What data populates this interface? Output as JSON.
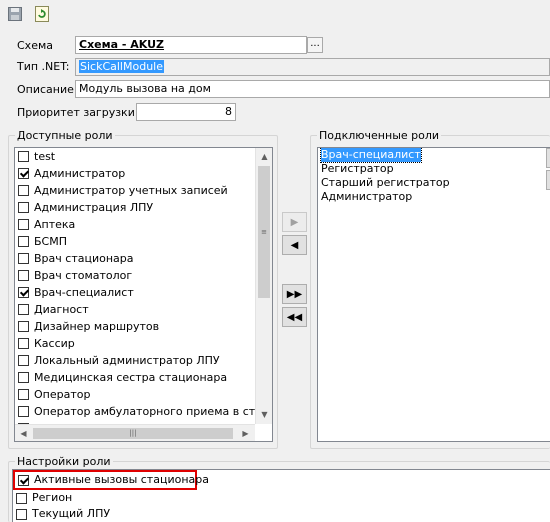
{
  "toolbar": {
    "save_icon": "save-icon",
    "refresh_icon": "refresh-icon"
  },
  "form": {
    "schema_label": "Схема",
    "schema_value": "Схема - AKUZ",
    "schema_button": "...",
    "type_label": "Тип .NET:",
    "type_value": "SickCallModule",
    "desc_label": "Описание:",
    "desc_value": "Модуль вызова на дом",
    "priority_label": "Приоритет загрузки:",
    "priority_value": "8"
  },
  "available_roles": {
    "title": "Доступные роли",
    "items": [
      {
        "label": "test",
        "checked": false
      },
      {
        "label": "Администратор",
        "checked": true
      },
      {
        "label": "Администратор учетных записей",
        "checked": false
      },
      {
        "label": "Администрация ЛПУ",
        "checked": false
      },
      {
        "label": "Аптека",
        "checked": false
      },
      {
        "label": "БСМП",
        "checked": false
      },
      {
        "label": "Врач стационара",
        "checked": false
      },
      {
        "label": "Врач стоматолог",
        "checked": false
      },
      {
        "label": "Врач-специалист",
        "checked": true
      },
      {
        "label": "Диагност",
        "checked": false
      },
      {
        "label": "Дизайнер маршрутов",
        "checked": false
      },
      {
        "label": "Кассир",
        "checked": false
      },
      {
        "label": "Локальный администратор ЛПУ",
        "checked": false
      },
      {
        "label": "Медицинская сестра стационара",
        "checked": false
      },
      {
        "label": "Оператор",
        "checked": false
      },
      {
        "label": "Оператор амбулаторного приема в стационаре",
        "checked": false
      }
    ]
  },
  "move_buttons": {
    "add": "▶",
    "remove": "◀",
    "add_all": "▶▶",
    "remove_all": "◀◀"
  },
  "connected_roles": {
    "title": "Подключенные роли",
    "items": [
      "Врач-специалист",
      "Регистратор",
      "Старший регистратор",
      "Администратор"
    ],
    "selected_index": 0
  },
  "role_settings": {
    "title": "Настройки роли",
    "items": [
      {
        "label": "Активные вызовы стационара",
        "checked": true
      },
      {
        "label": "Регион",
        "checked": false
      },
      {
        "label": "Текущий ЛПУ",
        "checked": false
      }
    ]
  },
  "colors": {
    "selection": "#3399ff",
    "highlight_border": "#e00000"
  }
}
